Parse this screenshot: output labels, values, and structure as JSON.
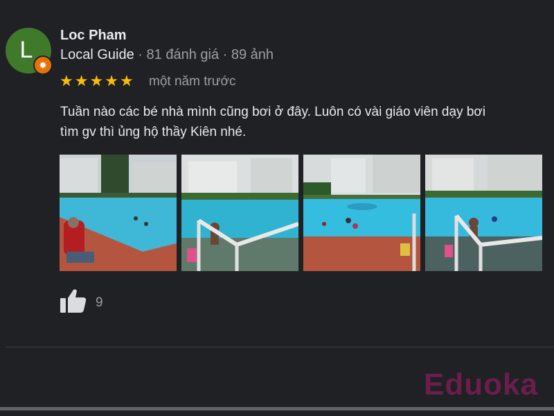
{
  "reviewer": {
    "initial": "L",
    "name": "Loc Pham",
    "badge_label": "Local Guide",
    "meta": " · 81 đánh giá · 89 ảnh"
  },
  "rating": {
    "stars": 5,
    "time": "một năm trước"
  },
  "review": {
    "line1": "Tuần nào các bé nhà mình cũng bơi ở đây. Luôn có vài giáo viên dạy bơi",
    "line2": "tìm gv thì ủng hộ thầy Kiên nhé."
  },
  "photos": [
    {
      "name": "review-photo-1",
      "scene": "pool-with-person-seated"
    },
    {
      "name": "review-photo-2",
      "scene": "pool-with-handrail"
    },
    {
      "name": "review-photo-3",
      "scene": "pool-wide-view"
    },
    {
      "name": "review-photo-4",
      "scene": "pool-with-handrail-right"
    }
  ],
  "likes": {
    "icon": "thumbs-up-icon",
    "count": "9"
  },
  "watermark": "Eduoka",
  "colors": {
    "background": "#202124",
    "text": "#e8eaed",
    "muted": "#9aa0a6",
    "star": "#fbbc04",
    "avatar": "#3f7a2a",
    "guide_badge": "#e8710a",
    "watermark": "#6b1e4c"
  }
}
